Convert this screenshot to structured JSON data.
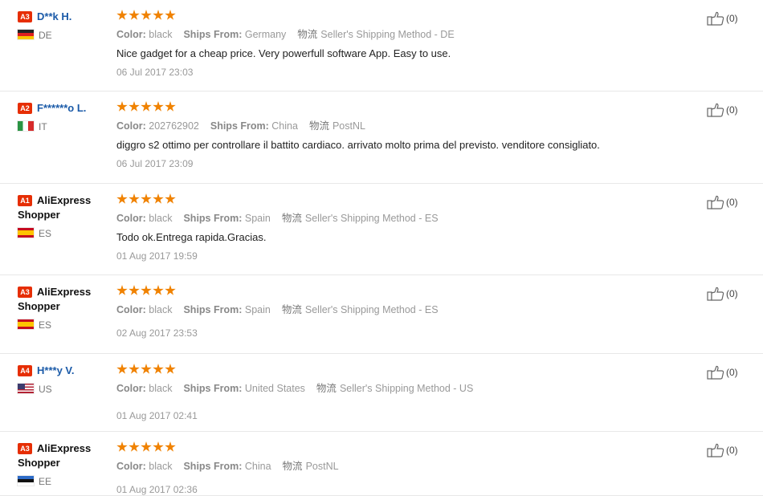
{
  "labels": {
    "color": "Color:",
    "ships_from": "Ships From:"
  },
  "icons": {
    "star": "star-icon",
    "thumbs_up": "thumbs-up-icon",
    "shipping": "物流"
  },
  "colors": {
    "accent": "#e62e04",
    "star": "#f08200",
    "username": "#1a5aa8"
  },
  "rating_max": 5,
  "reviews": [
    {
      "level": "A3",
      "name": "D**k H.",
      "name_style": "blue",
      "country": "DE",
      "flag": "de",
      "rating": 5,
      "color": "black",
      "ships_from": "Germany",
      "shipping_icon": "物流",
      "shipping_method": "Seller's Shipping Method - DE",
      "text": "Nice gadget for a cheap price. Very powerfull software App. Easy to use.",
      "date": "06 Jul 2017 23:03",
      "helpful": "(0)"
    },
    {
      "level": "A2",
      "name": "F******o L.",
      "name_style": "blue",
      "country": "IT",
      "flag": "it",
      "rating": 5,
      "color": "202762902",
      "ships_from": "China",
      "shipping_icon": "物流",
      "shipping_method": "PostNL",
      "text": "diggro s2 ottimo per controllare il battito cardiaco. arrivato molto prima del previsto. venditore consigliato.",
      "date": "06 Jul 2017 23:09",
      "helpful": "(0)"
    },
    {
      "level": "A1",
      "name": "AliExpress Shopper",
      "name_style": "black",
      "country": "ES",
      "flag": "es",
      "rating": 5,
      "color": "black",
      "ships_from": "Spain",
      "shipping_icon": "物流",
      "shipping_method": "Seller's Shipping Method - ES",
      "text": "Todo ok.Entrega rapida.Gracias.",
      "date": "01 Aug 2017 19:59",
      "helpful": "(0)"
    },
    {
      "level": "A3",
      "name": "AliExpress Shopper",
      "name_style": "black",
      "country": "ES",
      "flag": "es",
      "rating": 5,
      "color": "black",
      "ships_from": "Spain",
      "shipping_icon": "物流",
      "shipping_method": "Seller's Shipping Method - ES",
      "text": "",
      "date": "02 Aug 2017 23:53",
      "helpful": "(0)"
    },
    {
      "level": "A4",
      "name": "H***y V.",
      "name_style": "blue",
      "country": "US",
      "flag": "us",
      "rating": 5,
      "color": "black",
      "ships_from": "United States",
      "shipping_icon": "物流",
      "shipping_method": "Seller's Shipping Method - US",
      "text": "",
      "date": "01 Aug 2017 02:41",
      "helpful": "(0)"
    },
    {
      "level": "A3",
      "name": "AliExpress Shopper",
      "name_style": "black",
      "country": "EE",
      "flag": "ee",
      "rating": 5,
      "color": "black",
      "ships_from": "China",
      "shipping_icon": "物流",
      "shipping_method": "PostNL",
      "text": "",
      "date": "01 Aug 2017 02:36",
      "helpful": "(0)"
    }
  ]
}
